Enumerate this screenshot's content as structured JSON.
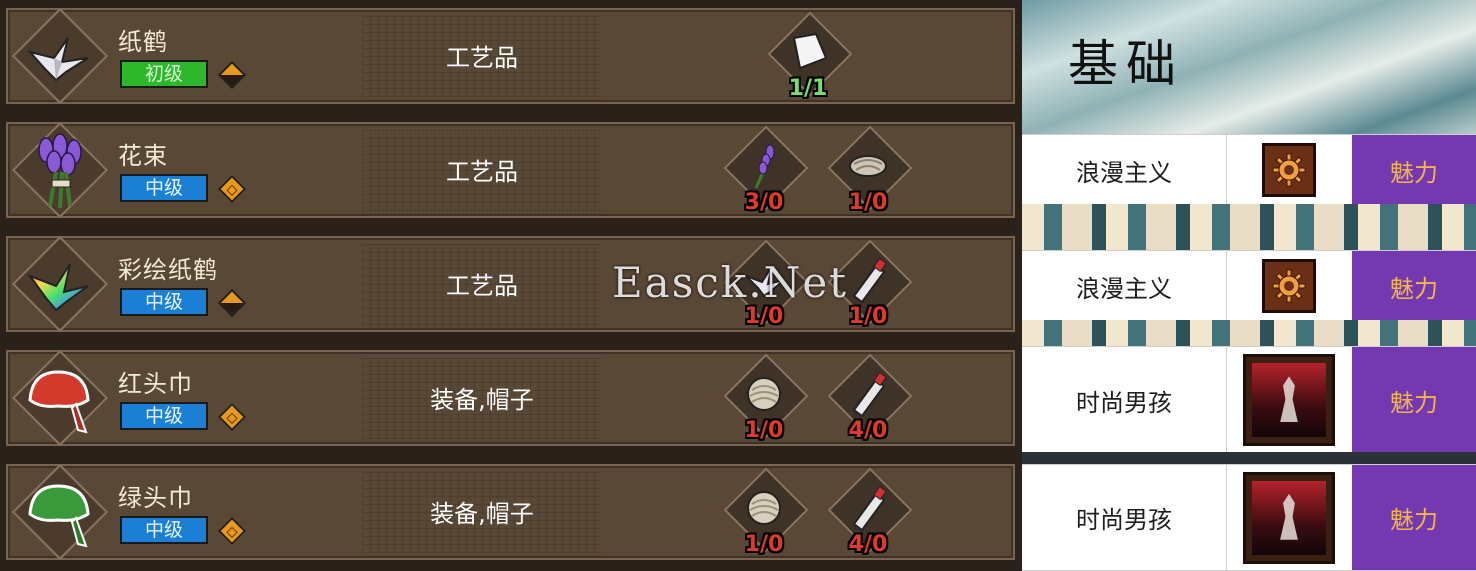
{
  "watermark": "Easck.Net",
  "craft_list": [
    {
      "name": "纸鹤",
      "tier": "初级",
      "tier_color": "#2db82b",
      "rarity_icon": "split-diamond-icon",
      "category": "工艺品",
      "item_icon": "paper-crane-icon",
      "materials": [
        {
          "icon": "paper-sheet-icon",
          "count": "1/1",
          "status": "ok"
        }
      ]
    },
    {
      "name": "花束",
      "tier": "中级",
      "tier_color": "#1b7fd6",
      "rarity_icon": "orange-diamond-icon",
      "category": "工艺品",
      "item_icon": "lavender-bouquet-icon",
      "materials": [
        {
          "icon": "lavender-sprig-icon",
          "count": "3/0",
          "status": "bad"
        },
        {
          "icon": "rope-bundle-icon",
          "count": "1/0",
          "status": "bad"
        }
      ]
    },
    {
      "name": "彩绘纸鹤",
      "tier": "中级",
      "tier_color": "#1b7fd6",
      "rarity_icon": "split-diamond-icon",
      "category": "工艺品",
      "item_icon": "rainbow-crane-icon",
      "materials": [
        {
          "icon": "paper-crane-icon",
          "count": "1/0",
          "status": "bad"
        },
        {
          "icon": "paint-tube-icon",
          "count": "1/0",
          "status": "bad"
        }
      ]
    },
    {
      "name": "红头巾",
      "tier": "中级",
      "tier_color": "#1b7fd6",
      "rarity_icon": "orange-diamond-icon",
      "category": "装备,帽子",
      "item_icon": "red-bandana-icon",
      "materials": [
        {
          "icon": "cloth-roll-icon",
          "count": "1/0",
          "status": "bad"
        },
        {
          "icon": "paint-tube-icon",
          "count": "4/0",
          "status": "bad"
        }
      ]
    },
    {
      "name": "绿头巾",
      "tier": "中级",
      "tier_color": "#1b7fd6",
      "rarity_icon": "orange-diamond-icon",
      "category": "装备,帽子",
      "item_icon": "green-bandana-icon",
      "materials": [
        {
          "icon": "cloth-roll-icon",
          "count": "1/0",
          "status": "bad"
        },
        {
          "icon": "paint-tube-icon",
          "count": "4/0",
          "status": "bad"
        }
      ]
    }
  ],
  "wiki": {
    "title": "基础",
    "rows": [
      {
        "name": "浪漫主义",
        "icon": "gear-badge-icon",
        "stat": "魅力"
      },
      {
        "name": "浪漫主义",
        "icon": "gear-badge-icon",
        "stat": "魅力"
      },
      {
        "name": "时尚男孩",
        "icon": "poster-portrait-icon",
        "stat": "魅力"
      },
      {
        "name": "时尚男孩",
        "icon": "poster-portrait-icon",
        "stat": "魅力"
      }
    ],
    "stat_color": "#7438b0",
    "stat_text_color": "#f2b54a"
  }
}
